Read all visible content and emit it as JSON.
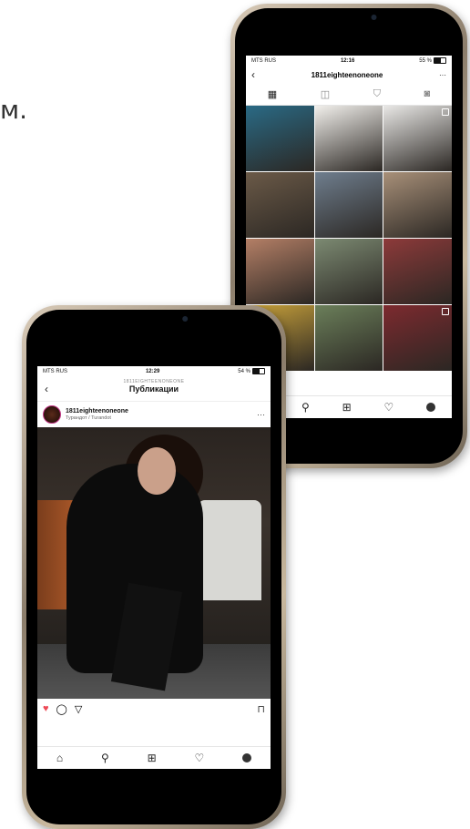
{
  "stray_text": "м.",
  "back_phone": {
    "status": {
      "carrier": "MTS RUS",
      "time": "12:16",
      "battery": "55 %"
    },
    "nav": {
      "title": "1811eighteenoneone",
      "back_icon": "chevron-left-icon",
      "more": "···"
    },
    "tabs": [
      {
        "icon": "grid-icon",
        "glyph": "▦"
      },
      {
        "icon": "tag-icon",
        "glyph": "◫"
      },
      {
        "icon": "shopping-bag-icon",
        "glyph": "⛉"
      },
      {
        "icon": "user-tag-icon",
        "glyph": "◙"
      }
    ],
    "grid_colors": [
      [
        "#2a6a85",
        "#f2f0ec",
        "#e9e8e6"
      ],
      [
        "#6b5a48",
        "#6f7e8e",
        "#a89079"
      ],
      [
        "#b47f66",
        "#7c8a72",
        "#8d3a3a"
      ],
      [
        "#c9a23b",
        "#6b7f5a",
        "#7d2a2f"
      ]
    ],
    "bottom_nav": [
      "home-icon",
      "search-icon",
      "add-icon",
      "heart-icon",
      "profile-icon"
    ]
  },
  "front_phone": {
    "status": {
      "carrier": "MTS RUS",
      "time": "12:29",
      "battery": "54 %"
    },
    "nav": {
      "sup_title": "1811EIGHTEENONEONE",
      "title": "Публикации"
    },
    "post": {
      "username": "1811eighteenoneone",
      "location": "Турандот / Turandot",
      "more": "···"
    },
    "bottom_nav": [
      "home-icon",
      "search-icon",
      "add-icon",
      "heart-icon",
      "profile-icon"
    ]
  }
}
